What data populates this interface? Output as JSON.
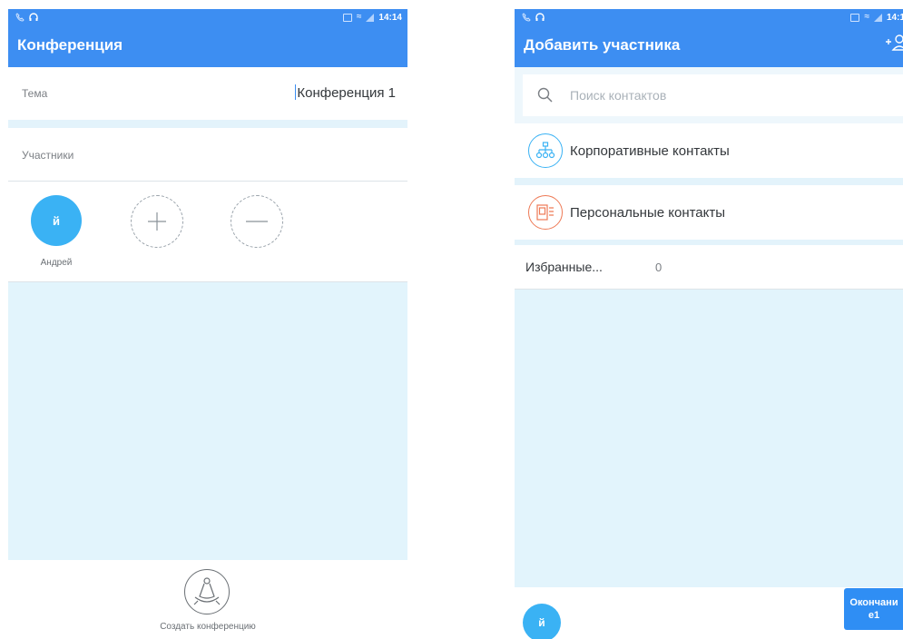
{
  "status_bar": {
    "left_time": "14:14",
    "right_time": "14:1"
  },
  "conference": {
    "title": "Конференция",
    "topic_label": "Тема",
    "topic_value": "Конференция 1",
    "participants_label": "Участники",
    "participants": [
      {
        "initial": "й",
        "name": "Андрей"
      }
    ],
    "create_label": "Создать конференцию"
  },
  "add_participant": {
    "title": "Добавить участника",
    "search_placeholder": "Поиск контактов",
    "corporate_label": "Корпоративные контакты",
    "personal_label": "Персональные контакты",
    "favorites_label": "Избранные...",
    "favorites_count": "0",
    "selected_initial": "й",
    "finish_label": "Окончание1"
  },
  "colors": {
    "primary": "#3d8ef2",
    "avatar": "#3ab2f4",
    "background_light": "#e2f4fc",
    "corporate_icon": "#3ab2f4",
    "personal_icon": "#ee7a56"
  }
}
